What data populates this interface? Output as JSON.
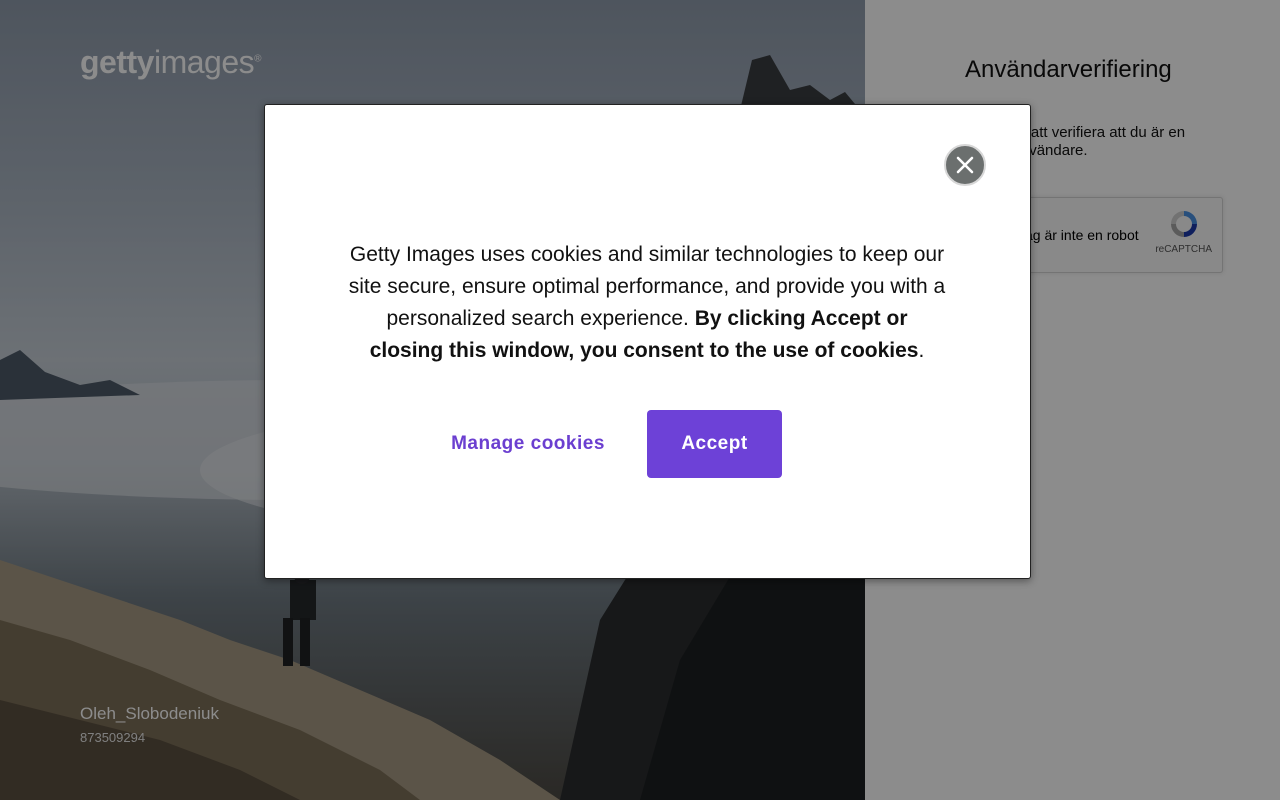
{
  "brand": {
    "logo_bold": "getty",
    "logo_light": "images",
    "logo_mark": "®"
  },
  "hero": {
    "photographer": "Oleh_Slobodeniuk",
    "image_id": "873509294"
  },
  "verification": {
    "title": "Användarverifiering",
    "text": "Klicka för att verifiera att du är en verklig användare.",
    "captcha_label": "Jag är inte en robot",
    "captcha_brand": "reCAPTCHA"
  },
  "cookie_modal": {
    "message_plain": "Getty Images uses cookies and similar technologies to keep our site secure, ensure optimal performance, and provide you with a personalized search experience.",
    "message_bold": "By clicking Accept or closing this window, you consent to the use of cookies",
    "message_end": ".",
    "manage_label": "Manage cookies",
    "accept_label": "Accept",
    "close_icon": "close-icon"
  },
  "colors": {
    "accent": "#6d41d7",
    "link": "#6b3fd0",
    "overlay": "rgba(0,0,0,0.45)",
    "close_bg": "#6b6f6e"
  }
}
